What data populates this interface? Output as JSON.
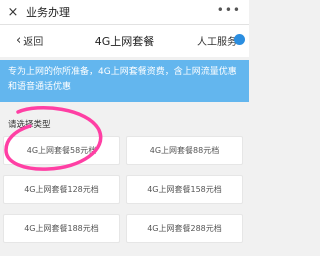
{
  "topbar": {
    "close_icon": "×",
    "title": "业务办理",
    "more_icon": "•••"
  },
  "navbar": {
    "back_label": "返回",
    "title": "4G上网套餐",
    "service_label": "人工服务",
    "service_dot": "●"
  },
  "banner": {
    "text": "专为上网的你所准备，4G上网套餐资费，含上网流量优惠和语音通话优惠"
  },
  "section": {
    "label": "请选择类型"
  },
  "packages": [
    "4G上网套餐58元档",
    "4G上网套餐88元档",
    "4G上网套餐128元档",
    "4G上网套餐158元档",
    "4G上网套餐188元档",
    "4G上网套餐288元档"
  ],
  "colors": {
    "banner": "#63b6ee",
    "annotation": "#ff3fa4",
    "accent": "#2b8ee0"
  }
}
